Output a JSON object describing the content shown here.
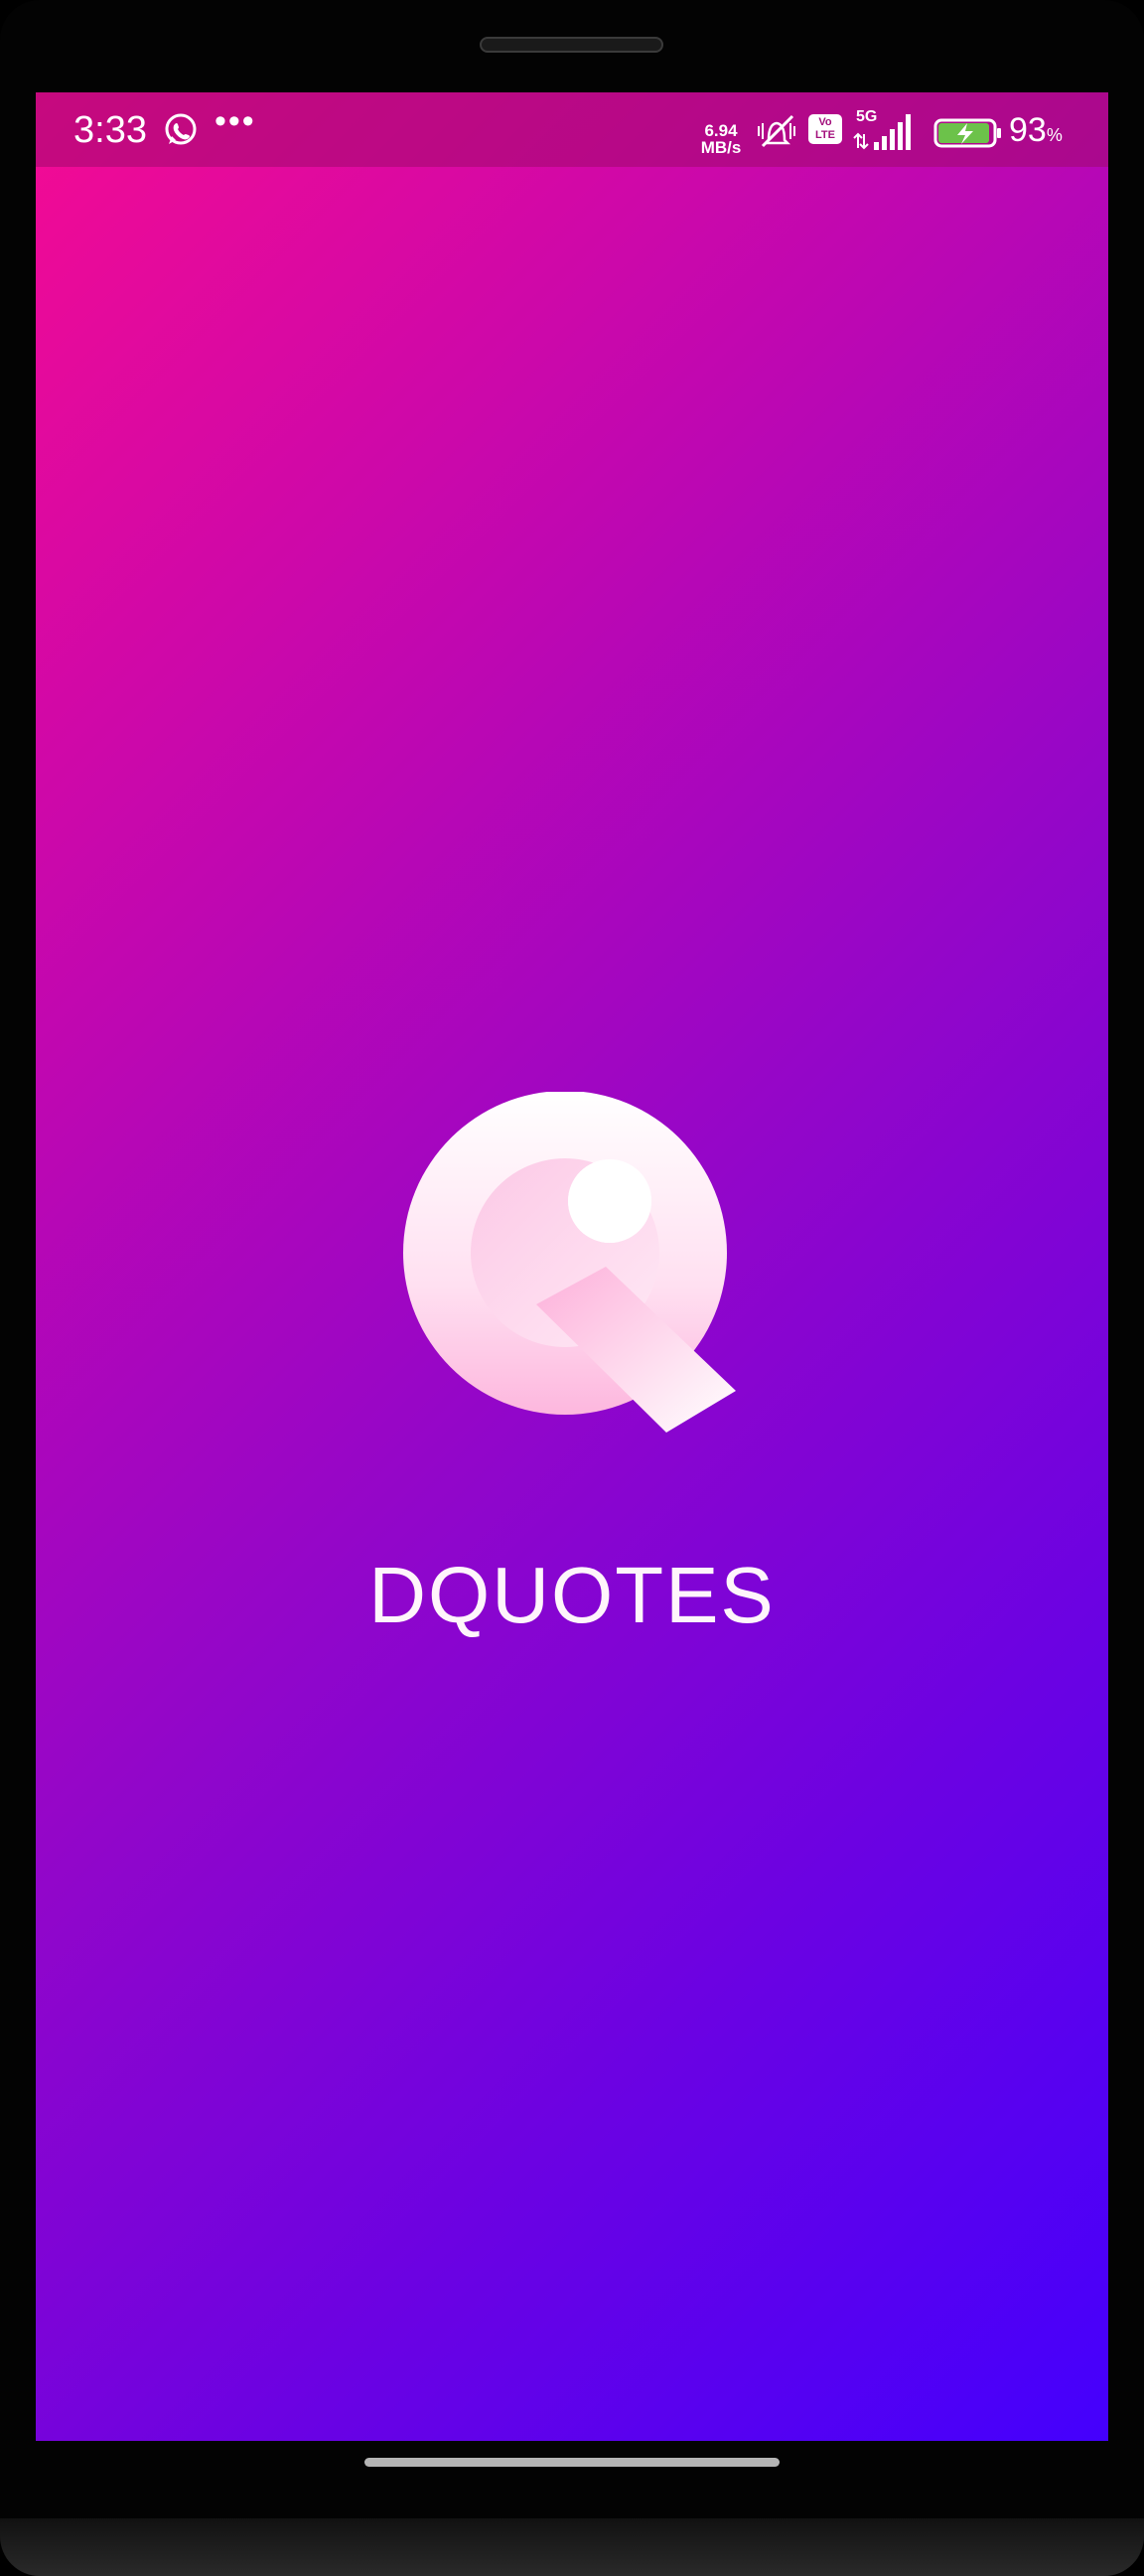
{
  "status_bar": {
    "time": "3:33",
    "notification_icons": [
      "whatsapp-icon",
      "more-icon"
    ],
    "more_glyph": "•••",
    "net_speed_value": "6.94",
    "net_speed_unit": "MB/s",
    "volte_top": "Vo",
    "volte_bottom": "LTE",
    "network_type": "5G",
    "battery_percent": "93",
    "battery_percent_sign": "%",
    "battery_charging": true
  },
  "splash": {
    "app_name": "DQUOTES",
    "logo_icon": "q-quote-logo-icon"
  },
  "colors": {
    "gradient_start": "#f40b93",
    "gradient_mid": "#9306c9",
    "gradient_end": "#4400fd",
    "battery_fill": "#6cc24a"
  }
}
